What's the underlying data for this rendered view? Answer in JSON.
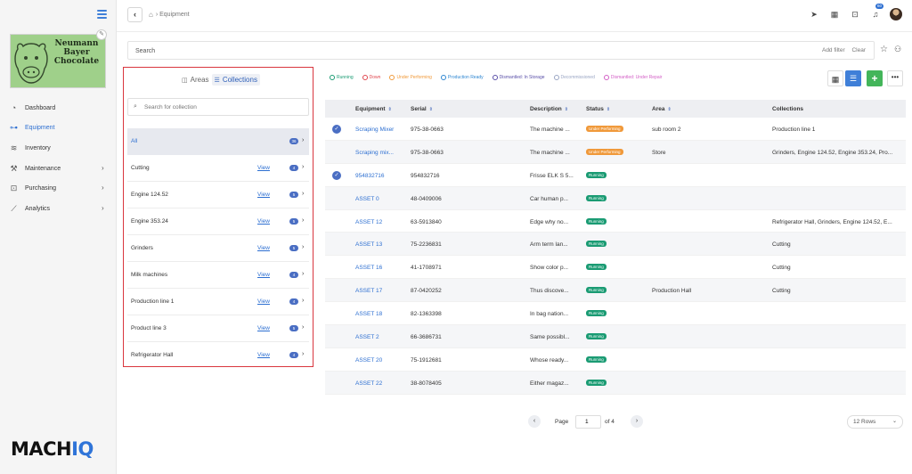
{
  "sidebar": {
    "logo_text": "Neumann Bayer Chocolate",
    "items": [
      {
        "label": "Dashboard",
        "icon": "dashboard-icon",
        "glyph": "◔",
        "chevron": false,
        "active": false
      },
      {
        "label": "Equipment",
        "icon": "equipment-icon",
        "glyph": "⊶",
        "chevron": false,
        "active": true
      },
      {
        "label": "Inventory",
        "icon": "inventory-icon",
        "glyph": "≋",
        "chevron": false,
        "active": false
      },
      {
        "label": "Maintenance",
        "icon": "wrench-icon",
        "glyph": "⚒",
        "chevron": true,
        "active": false
      },
      {
        "label": "Purchasing",
        "icon": "cart-icon",
        "glyph": "⊡",
        "chevron": true,
        "active": false
      },
      {
        "label": "Analytics",
        "icon": "analytics-icon",
        "glyph": "⟋",
        "chevron": true,
        "active": false
      }
    ],
    "brand_main": "MACH",
    "brand_accent": "IQ"
  },
  "topbar": {
    "breadcrumb": "Equipment",
    "notif_count": "60"
  },
  "search": {
    "placeholder": "Search",
    "add_filter": "Add filter",
    "clear": "Clear"
  },
  "collections_panel": {
    "tab_areas": "Areas",
    "tab_collections": "Collections",
    "search_placeholder": "Search for collection",
    "items": [
      {
        "name": "All",
        "view": "",
        "count": "36"
      },
      {
        "name": "Cutting",
        "view": "View",
        "count": "4"
      },
      {
        "name": "Engine 124.52",
        "view": "View",
        "count": "5"
      },
      {
        "name": "Engine 353.24",
        "view": "View",
        "count": "5"
      },
      {
        "name": "Grinders",
        "view": "View",
        "count": "5"
      },
      {
        "name": "Milk machines",
        "view": "View",
        "count": "4"
      },
      {
        "name": "Production line 1",
        "view": "View",
        "count": "4"
      },
      {
        "name": "Product line 3",
        "view": "View",
        "count": "5"
      },
      {
        "name": "Refrigerator Hall",
        "view": "View",
        "count": "4"
      }
    ]
  },
  "legend": [
    {
      "label": "Running",
      "color": "#1a9b73"
    },
    {
      "label": "Down",
      "color": "#e0464e"
    },
    {
      "label": "Under Performing",
      "color": "#f0993a"
    },
    {
      "label": "Production Ready",
      "color": "#2d86d1"
    },
    {
      "label": "Dismantled: In Storage",
      "color": "#5a4fa8"
    },
    {
      "label": "Decommissioned",
      "color": "#9aa6c4"
    },
    {
      "label": "Dismantled: Under Repair",
      "color": "#d35fc6"
    }
  ],
  "table": {
    "headers": [
      "Equipment",
      "Serial",
      "Description",
      "Status",
      "Area",
      "Collections"
    ],
    "rows": [
      {
        "check": true,
        "equipment": "Scraping Mixer",
        "serial": "975-38-0663",
        "description": "The machine ...",
        "status": "Under Performing",
        "status_color": "#f0993a",
        "area": "sub room 2",
        "collections": "Production line 1"
      },
      {
        "check": false,
        "equipment": "Scraping mix...",
        "serial": "975-38-0663",
        "description": "The machine ...",
        "status": "Under Performing",
        "status_color": "#f0993a",
        "area": "Store",
        "collections": "Grinders, Engine 124.52, Engine 353.24, Pro..."
      },
      {
        "check": true,
        "equipment": "954832716",
        "serial": "954832716",
        "description": "Frisse ELK S 5...",
        "status": "Running",
        "status_color": "#1a9b73",
        "area": "",
        "collections": ""
      },
      {
        "check": false,
        "equipment": "ASSET 0",
        "serial": "48-0409006",
        "description": "Car human p...",
        "status": "Running",
        "status_color": "#1a9b73",
        "area": "",
        "collections": ""
      },
      {
        "check": false,
        "equipment": "ASSET 12",
        "serial": "63-5913840",
        "description": "Edge why no...",
        "status": "Running",
        "status_color": "#1a9b73",
        "area": "",
        "collections": "Refrigerator Hall, Grinders, Engine 124.52, E..."
      },
      {
        "check": false,
        "equipment": "ASSET 13",
        "serial": "75-2236831",
        "description": "Arm term lan...",
        "status": "Running",
        "status_color": "#1a9b73",
        "area": "",
        "collections": "Cutting"
      },
      {
        "check": false,
        "equipment": "ASSET 16",
        "serial": "41-1708971",
        "description": "Show color p...",
        "status": "Running",
        "status_color": "#1a9b73",
        "area": "",
        "collections": "Cutting"
      },
      {
        "check": false,
        "equipment": "ASSET 17",
        "serial": "87-0420252",
        "description": "Thus discove...",
        "status": "Running",
        "status_color": "#1a9b73",
        "area": "Production Hall",
        "collections": "Cutting"
      },
      {
        "check": false,
        "equipment": "ASSET 18",
        "serial": "82-1363398",
        "description": "In bag nation...",
        "status": "Running",
        "status_color": "#1a9b73",
        "area": "",
        "collections": ""
      },
      {
        "check": false,
        "equipment": "ASSET 2",
        "serial": "66-3686731",
        "description": "Same possibl...",
        "status": "Running",
        "status_color": "#1a9b73",
        "area": "",
        "collections": ""
      },
      {
        "check": false,
        "equipment": "ASSET 20",
        "serial": "75-1912681",
        "description": "Whose ready...",
        "status": "Running",
        "status_color": "#1a9b73",
        "area": "",
        "collections": ""
      },
      {
        "check": false,
        "equipment": "ASSET 22",
        "serial": "38-8078405",
        "description": "Either magaz...",
        "status": "Running",
        "status_color": "#1a9b73",
        "area": "",
        "collections": ""
      }
    ]
  },
  "pagination": {
    "page_label": "Page",
    "current": "1",
    "of_label": "of 4",
    "rows_label": "12 Rows"
  }
}
